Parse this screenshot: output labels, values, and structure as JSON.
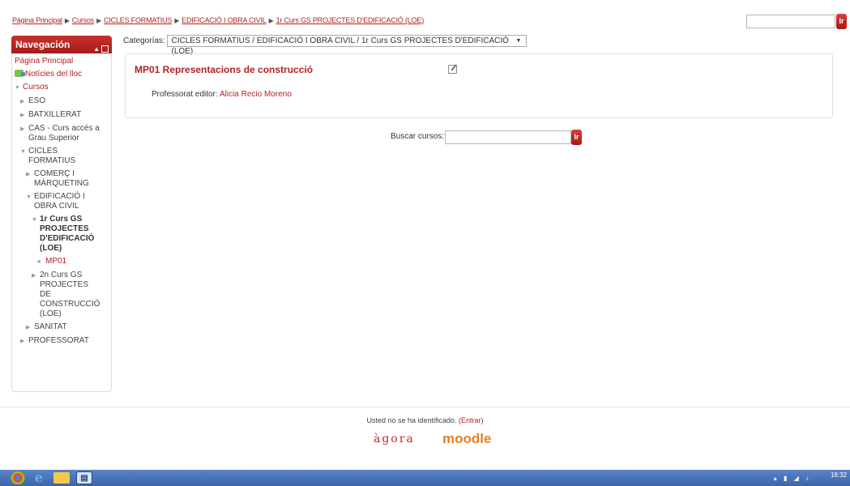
{
  "breadcrumb": {
    "items": [
      "Página Principal",
      "Cursos",
      "CICLES FORMATIUS",
      "EDIFICACIÓ I OBRA CIVIL",
      "1r Curs GS PROJECTES D'EDIFICACIÓ (LOE)"
    ],
    "separator": "▶"
  },
  "header": {
    "go_label": "Ir"
  },
  "navigation": {
    "title": "Navegación",
    "items": [
      "Página Principal",
      "Notícies del lloc",
      "Cursos",
      "ESO",
      "BATXILLERAT",
      "CAS - Curs accés a",
      "Grau Superior",
      "CICLES",
      "FORMATIUS",
      "COMERÇ I",
      "MÀRQUETING",
      "EDIFICACIÓ I",
      "OBRA CIVIL",
      "1r Curs GS",
      "PROJECTES",
      "D'EDIFICACIÓ",
      "(LOE)",
      "MP01",
      "2n Curs GS",
      "PROJECTES",
      "DE",
      "CONSTRUCCIÓ",
      "(LOE)",
      "SANITAT",
      "PROFESSORAT"
    ]
  },
  "categories": {
    "label": "Categorías:",
    "selected": "CICLES FORMATIUS / EDIFICACIÓ I OBRA CIVIL / 1r Curs GS PROJECTES D'EDIFICACIÓ (LOE)"
  },
  "course": {
    "title": "MP01 Representacions de construcció",
    "teacher_label": "Professorat editor:",
    "teacher_name": "Alicia Recio Moreno"
  },
  "search": {
    "label": "Buscar cursos:",
    "go_label": "Ir"
  },
  "footer": {
    "login_text": "Usted no se ha identificado.",
    "login_link": "(Entrar)",
    "agora_logo": "àgora",
    "moodle_logo": "moodle"
  },
  "taskbar": {
    "time": "18:32"
  }
}
